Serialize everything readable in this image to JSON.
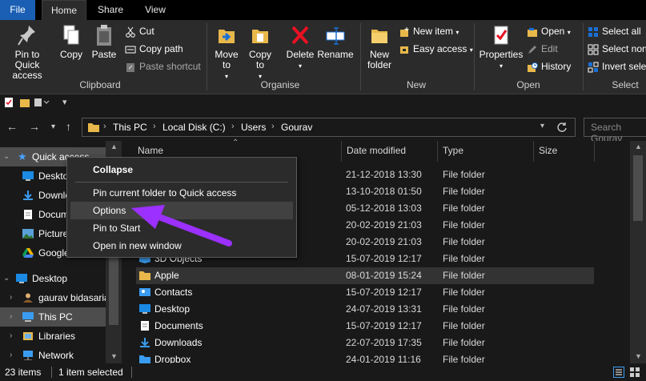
{
  "ribbon_tabs": [
    "File",
    "Home",
    "Share",
    "View"
  ],
  "clipboard": {
    "pin_label": "Pin to Quick access",
    "copy_label": "Copy",
    "paste_label": "Paste",
    "cut_label": "Cut",
    "copy_path_label": "Copy path",
    "paste_shortcut_label": "Paste shortcut",
    "group_label": "Clipboard"
  },
  "organise": {
    "move_to_label": "Move to",
    "copy_to_label": "Copy to",
    "delete_label": "Delete",
    "rename_label": "Rename",
    "group_label": "Organise"
  },
  "new_group": {
    "new_folder_label": "New folder",
    "new_item_label": "New item",
    "easy_access_label": "Easy access",
    "group_label": "New"
  },
  "open_group": {
    "properties_label": "Properties",
    "open_label": "Open",
    "edit_label": "Edit",
    "history_label": "History",
    "group_label": "Open"
  },
  "select_group": {
    "select_all_label": "Select all",
    "select_none_label": "Select non",
    "invert_label": "Invert sele",
    "group_label": "Select"
  },
  "address": {
    "crumbs": [
      "This PC",
      "Local Disk (C:)",
      "Users",
      "Gourav"
    ],
    "search_placeholder": "Search Gourav"
  },
  "nav": {
    "quick_access": "Quick access",
    "items": [
      "Desktop",
      "Downloads",
      "Documents",
      "Pictures",
      "Google Drive"
    ],
    "desktop": "Desktop",
    "user": "gaurav bidasaria",
    "this_pc": "This PC",
    "libraries": "Libraries",
    "network": "Network"
  },
  "columns": {
    "name": "Name",
    "date": "Date modified",
    "type": "Type",
    "size": "Size"
  },
  "files": [
    {
      "name": "",
      "date": "21-12-2018 13:30",
      "type": "File folder"
    },
    {
      "name": "",
      "date": "13-10-2018 01:50",
      "type": "File folder"
    },
    {
      "name": "",
      "date": "05-12-2018 13:03",
      "type": "File folder"
    },
    {
      "name": "",
      "date": "20-02-2019 21:03",
      "type": "File folder"
    },
    {
      "name": "",
      "date": "20-02-2019 21:03",
      "type": "File folder"
    },
    {
      "name": "3D Objects",
      "date": "15-07-2019 12:17",
      "type": "File folder"
    },
    {
      "name": "Apple",
      "date": "08-01-2019 15:24",
      "type": "File folder"
    },
    {
      "name": "Contacts",
      "date": "15-07-2019 12:17",
      "type": "File folder"
    },
    {
      "name": "Desktop",
      "date": "24-07-2019 13:31",
      "type": "File folder"
    },
    {
      "name": "Documents",
      "date": "15-07-2019 12:17",
      "type": "File folder"
    },
    {
      "name": "Downloads",
      "date": "22-07-2019 17:35",
      "type": "File folder"
    },
    {
      "name": "Dropbox",
      "date": "24-01-2019 11:16",
      "type": "File folder"
    }
  ],
  "context_menu": {
    "collapse": "Collapse",
    "pin_current": "Pin current folder to Quick access",
    "options": "Options",
    "pin_start": "Pin to Start",
    "open_new_window": "Open in new window"
  },
  "status": {
    "items": "23 items",
    "selected": "1 item selected"
  },
  "colors": {
    "accent": "#1a5fb4",
    "arrow": "#9b30ff",
    "folder": "#e8b84a",
    "delete_red": "#e81123"
  }
}
